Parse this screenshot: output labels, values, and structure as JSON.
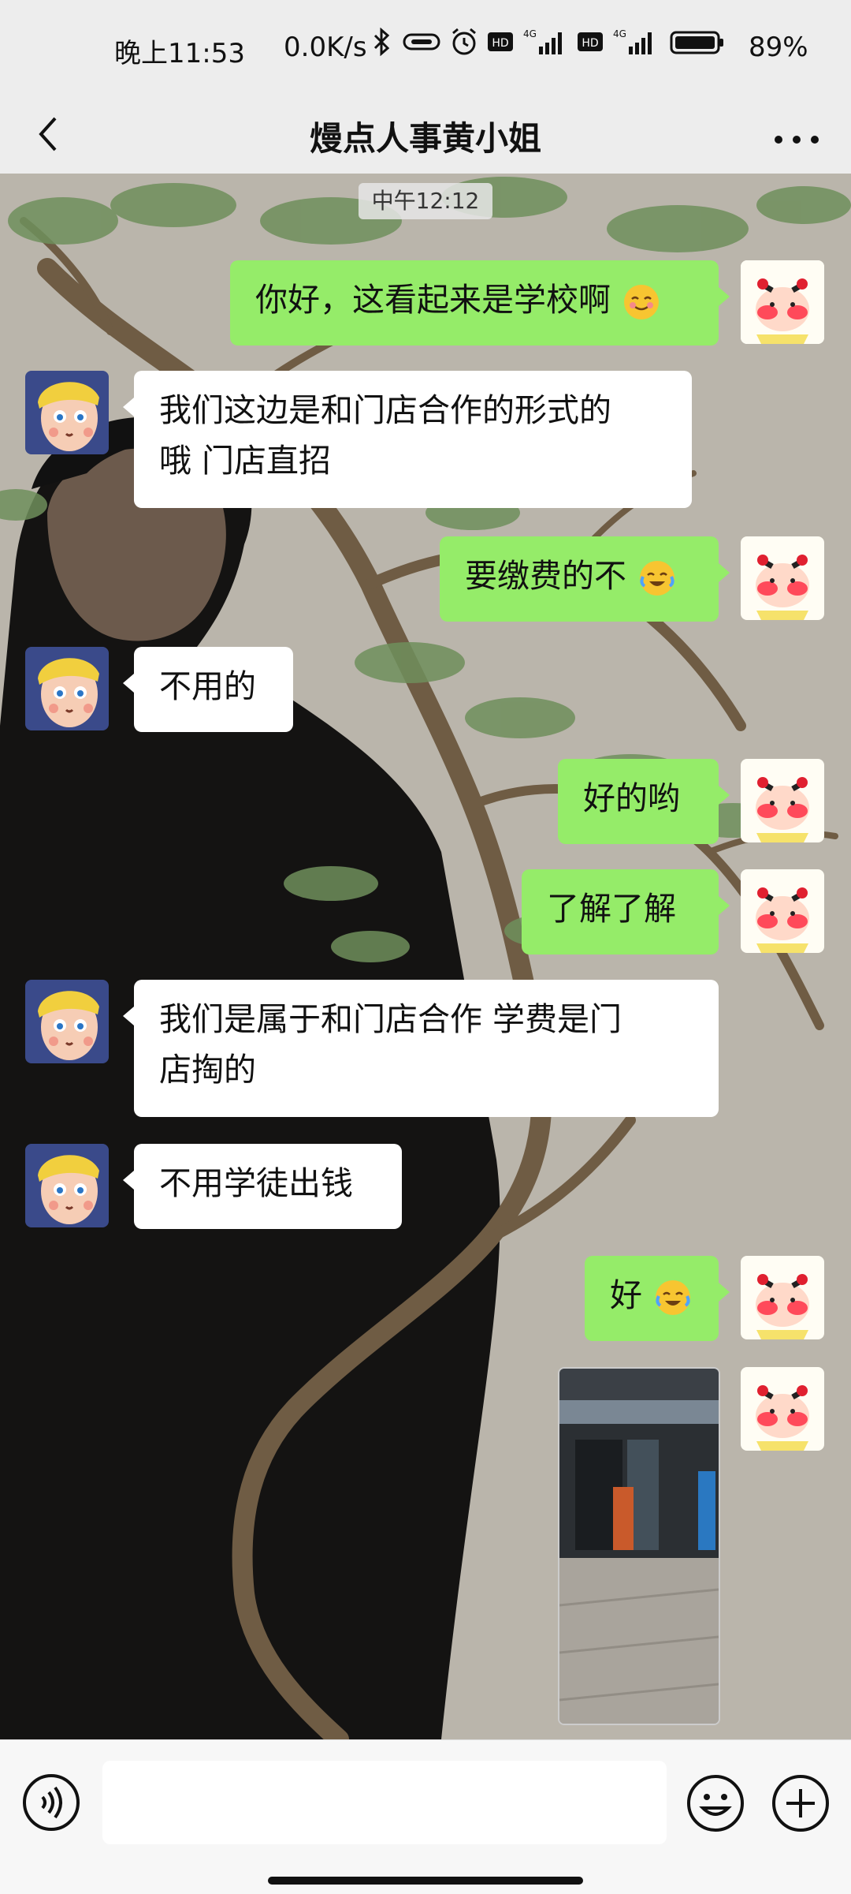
{
  "status_bar": {
    "time": "晚上11:53",
    "net_speed": "0.0K/s",
    "network_1": "4G",
    "network_2": "4G",
    "battery": "89%"
  },
  "header": {
    "title": "熳点人事黄小姐",
    "back_icon": "chevron-left-icon",
    "more_icon": "more-dots-icon"
  },
  "chat": {
    "timestamp": "中午12:12",
    "messages": [
      {
        "from": "me",
        "text": "你好，这看起来是学校啊",
        "emoji": "smile-emoji"
      },
      {
        "from": "them",
        "text": "我们这边是和门店合作的形式的\n哦  门店直招"
      },
      {
        "from": "me",
        "text": "要缴费的不",
        "emoji": "laugh-cry-emoji"
      },
      {
        "from": "them",
        "text": "不用的"
      },
      {
        "from": "me",
        "text": "好的哟"
      },
      {
        "from": "me",
        "text": "了解了解"
      },
      {
        "from": "them",
        "text": "我们是属于和门店合作 学费是门\n店掏的"
      },
      {
        "from": "them",
        "text": "不用学徒出钱"
      },
      {
        "from": "me",
        "text": "好",
        "emoji": "laugh-cry-emoji"
      },
      {
        "from": "me",
        "type": "image",
        "alt": "storefront-photo"
      }
    ]
  },
  "input_bar": {
    "voice_icon": "voice-icon",
    "emoji_icon": "emoji-icon",
    "plus_icon": "plus-icon",
    "placeholder": ""
  },
  "colors": {
    "me_bubble": "#95ec69",
    "them_bubble": "#ffffff",
    "bar_bg": "#ededed"
  }
}
